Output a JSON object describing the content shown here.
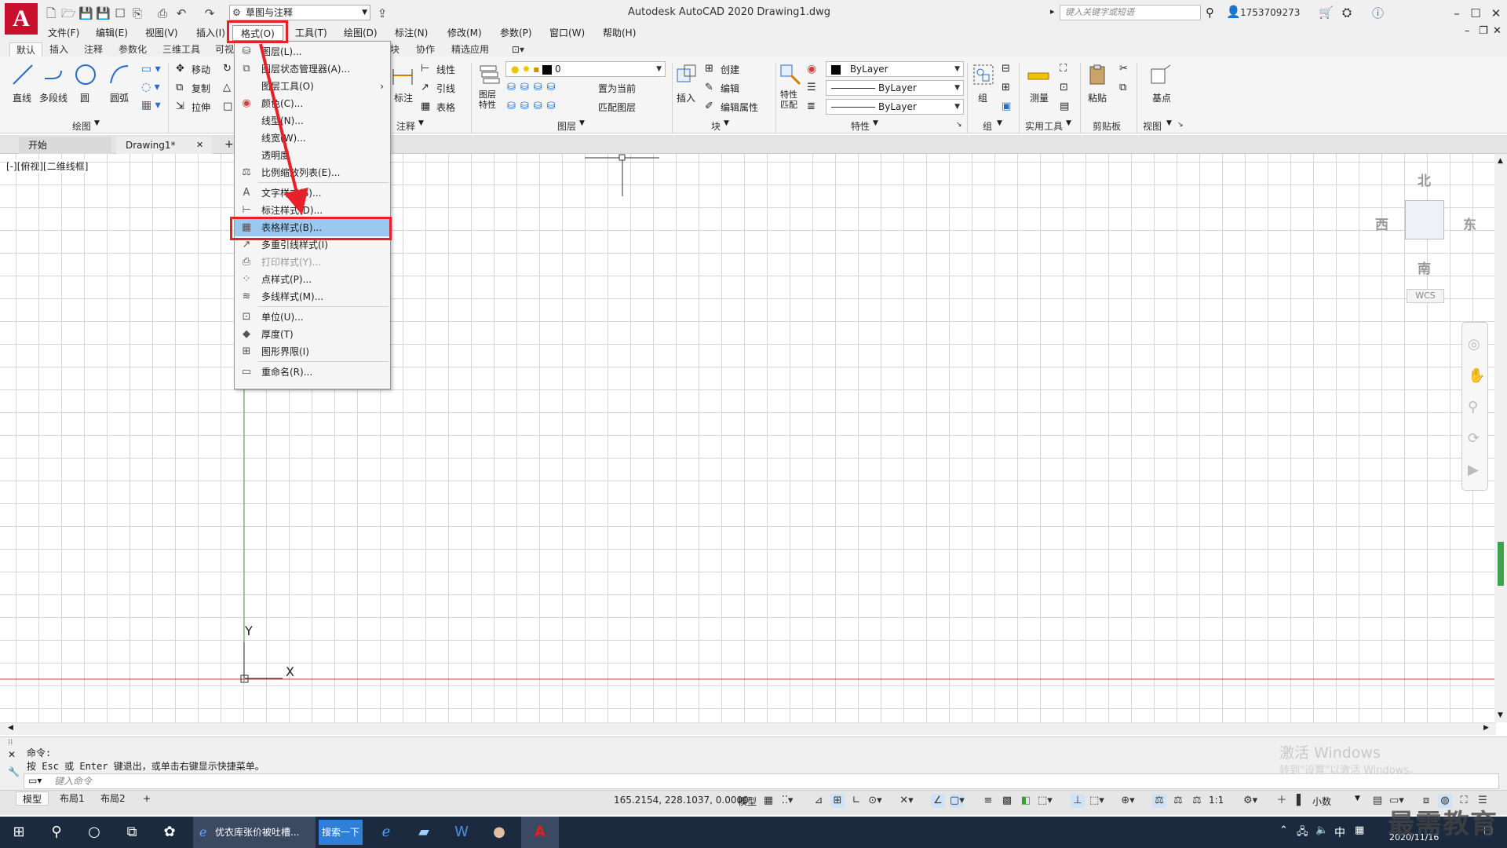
{
  "titlebar": {
    "workspace": "草图与注释",
    "app_title": "Autodesk AutoCAD 2020    Drawing1.dwg",
    "search_placeholder": "键入关键字或短语",
    "user": "1753709273"
  },
  "menubar": {
    "items": [
      "文件(F)",
      "编辑(E)",
      "视图(V)",
      "插入(I)",
      "格式(O)",
      "工具(T)",
      "绘图(D)",
      "标注(N)",
      "修改(M)",
      "参数(P)",
      "窗口(W)",
      "帮助(H)"
    ]
  },
  "ribbon_tabs": [
    "默认",
    "插入",
    "注释",
    "参数化",
    "三维工具",
    "可视",
    "块",
    "协作",
    "精选应用"
  ],
  "ribbon": {
    "draw": {
      "line": "直线",
      "polyline": "多段线",
      "circle": "圆",
      "arc": "圆弧",
      "title": "绘图"
    },
    "modify": {
      "move": "移动",
      "copy": "复制",
      "stretch": "拉伸"
    },
    "annotation": {
      "dimension": "标注",
      "linear": "线性",
      "leader": "引线",
      "table": "表格",
      "title": "注释"
    },
    "layers": {
      "layer_props": "图层特性",
      "layer_name": "0",
      "set_current": "置为当前",
      "match_layer": "匹配图层",
      "title": "图层"
    },
    "block": {
      "insert": "插入",
      "create": "创建",
      "edit": "编辑",
      "edit_attr": "编辑属性",
      "title": "块"
    },
    "properties": {
      "match": "特性匹配",
      "color": "ByLayer",
      "linetype": "ByLayer",
      "lineweight": "ByLayer",
      "title": "特性"
    },
    "groups": {
      "group": "组",
      "title": "组"
    },
    "utilities": {
      "measure": "测量",
      "title": "实用工具"
    },
    "clipboard": {
      "paste": "粘贴",
      "title": "剪贴板"
    },
    "view": {
      "base": "基点",
      "title": "视图"
    }
  },
  "doc_tabs": {
    "start": "开始",
    "drawing": "Drawing1*",
    "close": "✕",
    "add": "+"
  },
  "viewport_label": "[-][俯视][二维线框]",
  "viewcube": {
    "north": "北",
    "south": "南",
    "east": "东",
    "west": "西",
    "wcs": "WCS"
  },
  "axes": {
    "y": "Y",
    "x": "X"
  },
  "format_menu": [
    {
      "label": "图层(L)...",
      "icon": "layer-icon",
      "enabled": true
    },
    {
      "label": "图层状态管理器(A)...",
      "icon": "layer-state-icon",
      "enabled": true
    },
    {
      "label": "图层工具(O)",
      "icon": "",
      "enabled": true,
      "submenu": true
    },
    {
      "label": "颜色(C)...",
      "icon": "color-wheel-icon",
      "enabled": true
    },
    {
      "label": "线型(N)...",
      "icon": "",
      "enabled": true
    },
    {
      "label": "线宽(W)...",
      "icon": "",
      "enabled": true
    },
    {
      "label": "透明度",
      "icon": "",
      "enabled": true
    },
    {
      "label": "比例缩放列表(E)...",
      "icon": "scale-list-icon",
      "enabled": true
    },
    {
      "label": "文字样式(S)...",
      "icon": "text-style-icon",
      "enabled": true
    },
    {
      "label": "标注样式(D)...",
      "icon": "dim-style-icon",
      "enabled": true
    },
    {
      "label": "表格样式(B)...",
      "icon": "table-style-icon",
      "enabled": true,
      "highlighted": true
    },
    {
      "label": "多重引线样式(I)",
      "icon": "mleader-style-icon",
      "enabled": true
    },
    {
      "label": "打印样式(Y)...",
      "icon": "plot-style-icon",
      "enabled": false
    },
    {
      "label": "点样式(P)...",
      "icon": "point-style-icon",
      "enabled": true
    },
    {
      "label": "多线样式(M)...",
      "icon": "mline-style-icon",
      "enabled": true
    },
    {
      "label": "单位(U)...",
      "icon": "units-icon",
      "enabled": true
    },
    {
      "label": "厚度(T)",
      "icon": "thickness-icon",
      "enabled": true
    },
    {
      "label": "图形界限(I)",
      "icon": "limits-icon",
      "enabled": true
    },
    {
      "label": "重命名(R)...",
      "icon": "rename-icon",
      "enabled": true
    }
  ],
  "command": {
    "line1": "命令:",
    "line2": "按 Esc 或 Enter 键退出，或单击右键显示快捷菜单。",
    "input_placeholder": "键入命令"
  },
  "watermark": {
    "line1": "激活 Windows",
    "line2": "转到\"设置\"以激活 Windows。"
  },
  "status": {
    "tabs": [
      "模型",
      "布局1",
      "布局2"
    ],
    "add": "+",
    "coords": "165.2154, 228.1037, 0.0000",
    "model": "模型",
    "scale": "1:1",
    "units": "小数"
  },
  "taskbar": {
    "browser_title": "优衣库张价被吐槽...",
    "search_button": "搜索一下",
    "ime": "中",
    "date": "2020/11/16"
  },
  "brand": "最需教育",
  "colors": {
    "accent": "#99c9f1",
    "annotation": "#e8202a",
    "app_red": "#c8102e"
  }
}
